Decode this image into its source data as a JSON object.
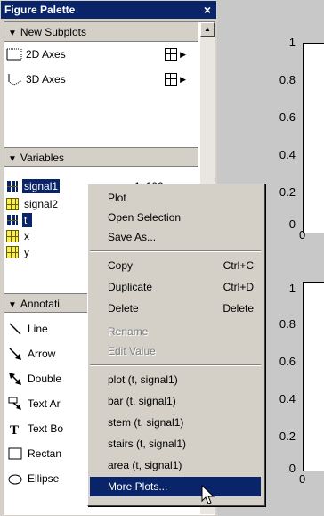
{
  "palette": {
    "title": "Figure Palette",
    "close_symbol": "×",
    "new_subplots": {
      "header": "New Subplots",
      "items": [
        {
          "label": "2D Axes",
          "icon": "2d-axes-icon"
        },
        {
          "label": "3D Axes",
          "icon": "3d-axes-icon"
        }
      ]
    },
    "variables": {
      "header": "Variables",
      "items": [
        {
          "name": "signal1",
          "size": "1x100",
          "selected": true
        },
        {
          "name": "signal2",
          "size": "",
          "selected": false
        },
        {
          "name": "t",
          "size": "",
          "selected": true
        },
        {
          "name": "x",
          "size": "",
          "selected": false
        },
        {
          "name": "y",
          "size": "",
          "selected": false
        }
      ]
    },
    "annotations": {
      "header": "Annotati",
      "items": [
        {
          "label": "Line"
        },
        {
          "label": "Arrow"
        },
        {
          "label": "Double"
        },
        {
          "label": "Text Ar"
        },
        {
          "label": "Text Bo"
        },
        {
          "label": "Rectan"
        },
        {
          "label": "Ellipse"
        }
      ]
    }
  },
  "axes": {
    "top": {
      "y_ticks": [
        "1",
        "0.8",
        "0.6",
        "0.4",
        "0.2",
        "0"
      ],
      "x_tick": "0"
    },
    "bottom": {
      "y_ticks": [
        "1",
        "0.8",
        "0.6",
        "0.4",
        "0.2",
        "0"
      ],
      "x_tick": "0"
    }
  },
  "context_menu": {
    "items": [
      {
        "label": "Plot",
        "shortcut": "",
        "disabled": false
      },
      {
        "label": "Open Selection",
        "shortcut": "",
        "disabled": false
      },
      {
        "label": "Save As...",
        "shortcut": "",
        "disabled": false
      },
      {
        "label": "Copy",
        "shortcut": "Ctrl+C",
        "disabled": false
      },
      {
        "label": "Duplicate",
        "shortcut": "Ctrl+D",
        "disabled": false
      },
      {
        "label": "Delete",
        "shortcut": "Delete",
        "disabled": false
      },
      {
        "label": "Rename",
        "shortcut": "",
        "disabled": true
      },
      {
        "label": "Edit Value",
        "shortcut": "",
        "disabled": true
      },
      {
        "label": "plot (t, signal1)",
        "shortcut": "",
        "disabled": false
      },
      {
        "label": "bar (t, signal1)",
        "shortcut": "",
        "disabled": false
      },
      {
        "label": "stem (t, signal1)",
        "shortcut": "",
        "disabled": false
      },
      {
        "label": "stairs (t, signal1)",
        "shortcut": "",
        "disabled": false
      },
      {
        "label": "area (t, signal1)",
        "shortcut": "",
        "disabled": false
      },
      {
        "label": "More Plots...",
        "shortcut": "",
        "disabled": false,
        "highlighted": true
      }
    ]
  },
  "colors": {
    "selection": "#0a246a",
    "variable_icon": "#f7f055"
  }
}
